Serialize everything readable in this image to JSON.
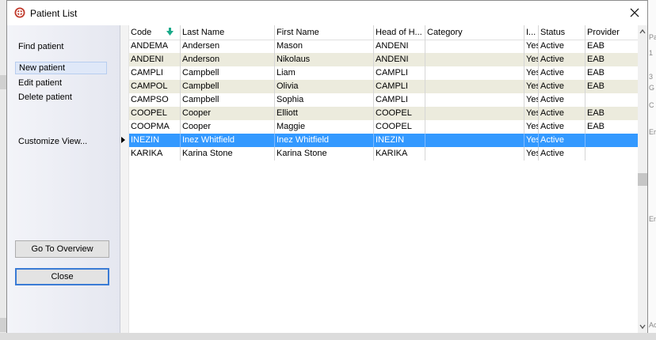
{
  "window": {
    "title": "Patient List"
  },
  "nav": {
    "find": "Find patient",
    "new": "New patient",
    "edit": "Edit patient",
    "delete": "Delete patient",
    "customize": "Customize View..."
  },
  "buttons": {
    "overview": "Go To Overview",
    "close": "Close"
  },
  "grid": {
    "columns": [
      "Code",
      "Last Name",
      "First Name",
      "Head of H...",
      "Category",
      "I...",
      "Status",
      "Provider"
    ],
    "sort_column": "Code",
    "selected_row": 7,
    "rows": [
      [
        "ANDEMA",
        "Andersen",
        "Mason",
        "ANDENI",
        "",
        "Yes",
        "Active",
        "EAB"
      ],
      [
        "ANDENI",
        "Anderson",
        "Nikolaus",
        "ANDENI",
        "",
        "Yes",
        "Active",
        "EAB"
      ],
      [
        "CAMPLI",
        "Campbell",
        "Liam",
        "CAMPLI",
        "",
        "Yes",
        "Active",
        "EAB"
      ],
      [
        "CAMPOL",
        "Campbell",
        "Olivia",
        "CAMPLI",
        "",
        "Yes",
        "Active",
        "EAB"
      ],
      [
        "CAMPSO",
        "Campbell",
        "Sophia",
        "CAMPLI",
        "",
        "Yes",
        "Active",
        ""
      ],
      [
        "COOPEL",
        "Cooper",
        "Elliott",
        "COOPEL",
        "",
        "Yes",
        "Active",
        "EAB"
      ],
      [
        "COOPMA",
        "Cooper",
        "Maggie",
        "COOPEL",
        "",
        "Yes",
        "Active",
        "EAB"
      ],
      [
        "INEZIN",
        "Inez Whitfield",
        "Inez Whitfield",
        "INEZIN",
        "",
        "Yes",
        "Active",
        ""
      ],
      [
        "KARIKA",
        "Karina Stone",
        "Karina Stone",
        "KARIKA",
        "",
        "Yes",
        "Active",
        ""
      ]
    ]
  },
  "colors": {
    "selection": "#3399ff",
    "alt_row": "#ecebdd",
    "sort_arrow": "#1aaa8a",
    "app_icon": "#c0392b"
  },
  "background_fragments": [
    "Pa",
    "1",
    "3",
    "G",
    "C",
    "Er",
    "En",
    "Ac"
  ]
}
